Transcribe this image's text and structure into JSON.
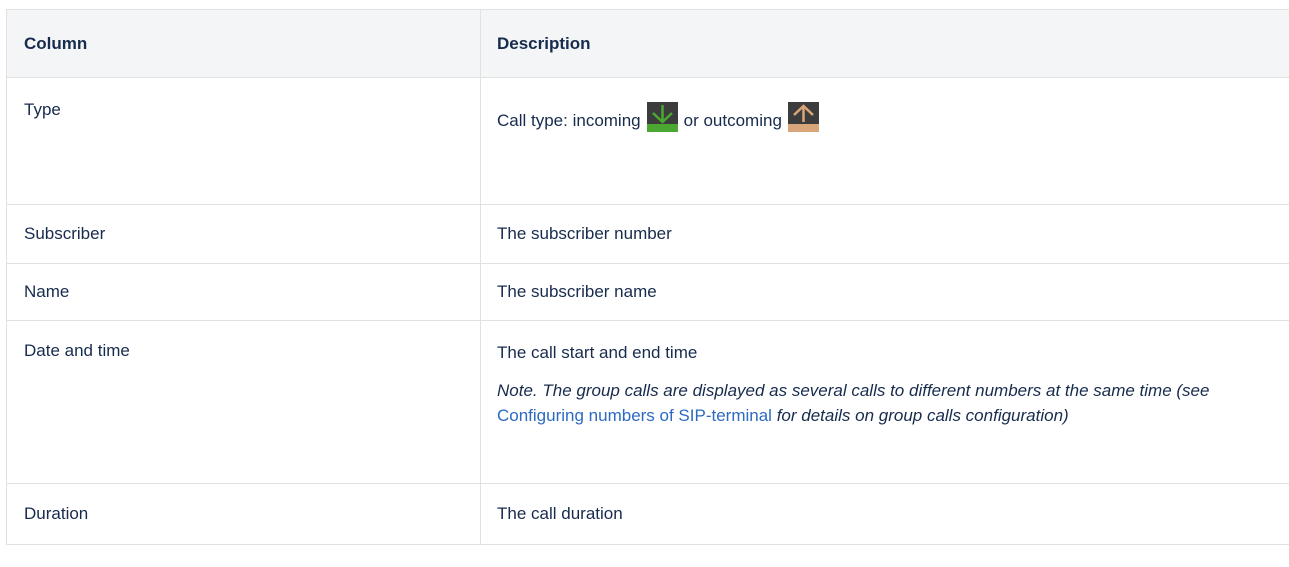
{
  "table": {
    "headers": {
      "column": "Column",
      "description": "Description"
    },
    "rows": [
      {
        "name": "Type",
        "desc_prefix": "Call type: incoming",
        "desc_middle": "or outcoming",
        "incoming_icon": "incoming-arrow-down-icon",
        "outgoing_icon": "outgoing-arrow-up-icon"
      },
      {
        "name": "Subscriber",
        "desc": "The subscriber number"
      },
      {
        "name": "Name",
        "desc": "The subscriber name"
      },
      {
        "name": "Date and time",
        "desc": "The call start and end time",
        "note_before": "Note. The group calls are displayed as several calls to different numbers at the same time (see ",
        "note_link": "Configuring numbers of SIP-terminal",
        "note_after": " for details on group calls configuration)"
      },
      {
        "name": "Duration",
        "desc": "The call duration"
      }
    ]
  },
  "colors": {
    "header_bg": "#f4f5f7",
    "border": "#e1e1e1",
    "text": "#172b4d",
    "link": "#2d6ac2",
    "incoming_icon_bg": "#3c3c3c",
    "incoming_arrow": "#4aa832",
    "outgoing_icon_bg": "#3c3c3c",
    "outgoing_arrow": "#d9a679"
  }
}
